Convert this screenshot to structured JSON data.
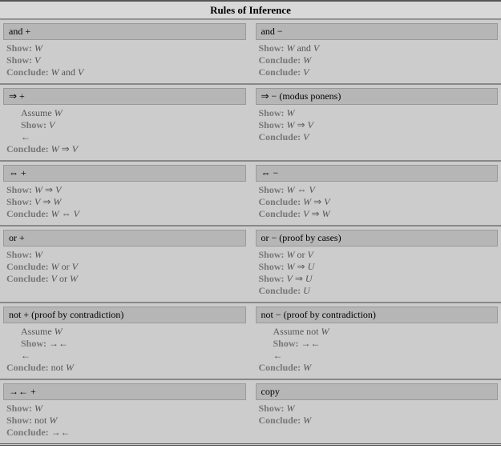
{
  "title": "Rules of Inference",
  "rules": [
    {
      "left": {
        "header": "and +",
        "lines": [
          {
            "kw": "Show:",
            "rest": " W",
            "indent": 0
          },
          {
            "kw": "Show:",
            "rest": " V",
            "indent": 0
          },
          {
            "kw": "Conclude:",
            "rest": " W and V",
            "indent": 0
          }
        ]
      },
      "right": {
        "header": "and −",
        "lines": [
          {
            "kw": "Show:",
            "rest": " W and V",
            "indent": 0
          },
          {
            "kw": "Conclude:",
            "rest": " W",
            "indent": 0
          },
          {
            "kw": "Conclude:",
            "rest": " V",
            "indent": 0
          }
        ]
      }
    },
    {
      "left": {
        "header": "⇒ +",
        "lines": [
          {
            "kw": "",
            "rest": "Assume W",
            "indent": 1,
            "assume": true
          },
          {
            "kw": "Show:",
            "rest": " V",
            "indent": 1
          },
          {
            "kw": "",
            "rest": "←",
            "indent": 1
          },
          {
            "kw": "Conclude:",
            "rest": " W ⇒ V",
            "indent": 0
          }
        ]
      },
      "right": {
        "header": "⇒ − (modus ponens)",
        "lines": [
          {
            "kw": "Show:",
            "rest": " W",
            "indent": 0
          },
          {
            "kw": "Show:",
            "rest": " W ⇒ V",
            "indent": 0
          },
          {
            "kw": "Conclude:",
            "rest": " V",
            "indent": 0
          }
        ]
      }
    },
    {
      "left": {
        "header": "⇔ +",
        "lines": [
          {
            "kw": "Show:",
            "rest": " W ⇒ V",
            "indent": 0
          },
          {
            "kw": "Show:",
            "rest": " V ⇒ W",
            "indent": 0
          },
          {
            "kw": "Conclude:",
            "rest": " W ⇔ V",
            "indent": 0
          }
        ]
      },
      "right": {
        "header": "⇔ −",
        "lines": [
          {
            "kw": "Show:",
            "rest": " W ⇔ V",
            "indent": 0
          },
          {
            "kw": "Conclude:",
            "rest": " W ⇒ V",
            "indent": 0
          },
          {
            "kw": "Conclude:",
            "rest": " V ⇒ W",
            "indent": 0
          }
        ]
      }
    },
    {
      "left": {
        "header": "or +",
        "lines": [
          {
            "kw": "Show:",
            "rest": " W",
            "indent": 0
          },
          {
            "kw": "Conclude:",
            "rest": " W or V",
            "indent": 0
          },
          {
            "kw": "Conclude:",
            "rest": " V or W",
            "indent": 0
          }
        ]
      },
      "right": {
        "header": "or − (proof by cases)",
        "lines": [
          {
            "kw": "Show:",
            "rest": " W or V",
            "indent": 0
          },
          {
            "kw": "Show:",
            "rest": " W ⇒ U",
            "indent": 0
          },
          {
            "kw": "Show:",
            "rest": " V ⇒ U",
            "indent": 0
          },
          {
            "kw": "Conclude:",
            "rest": " U",
            "indent": 0
          }
        ]
      }
    },
    {
      "left": {
        "header": "not + (proof by contradiction)",
        "lines": [
          {
            "kw": "",
            "rest": "Assume W",
            "indent": 1,
            "assume": true
          },
          {
            "kw": "Show:",
            "rest": " →←",
            "indent": 1
          },
          {
            "kw": "",
            "rest": "←",
            "indent": 1
          },
          {
            "kw": "Conclude:",
            "rest": " not W",
            "indent": 0
          }
        ]
      },
      "right": {
        "header": "not − (proof by contradiction)",
        "lines": [
          {
            "kw": "",
            "rest": "Assume not W",
            "indent": 1,
            "assume": true
          },
          {
            "kw": "Show:",
            "rest": " →←",
            "indent": 1
          },
          {
            "kw": "",
            "rest": "←",
            "indent": 1
          },
          {
            "kw": "Conclude:",
            "rest": " W",
            "indent": 0
          }
        ]
      }
    },
    {
      "left": {
        "header": "→← +",
        "lines": [
          {
            "kw": "Show:",
            "rest": " W",
            "indent": 0
          },
          {
            "kw": "Show:",
            "rest": " not W",
            "indent": 0
          },
          {
            "kw": "Conclude:",
            "rest": " →←",
            "indent": 0
          }
        ]
      },
      "right": {
        "header": "copy",
        "lines": [
          {
            "kw": "Show:",
            "rest": " W",
            "indent": 0
          },
          {
            "kw": "Conclude:",
            "rest": " W",
            "indent": 0
          }
        ]
      }
    }
  ]
}
